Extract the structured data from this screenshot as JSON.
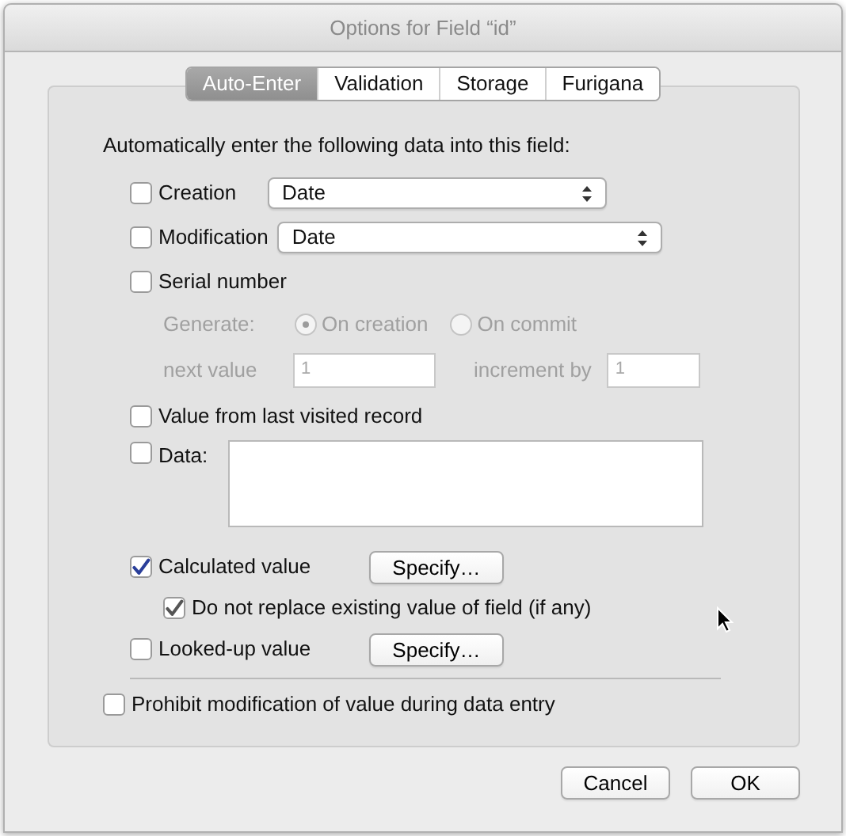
{
  "window": {
    "title": "Options for Field “id”"
  },
  "tabs": [
    {
      "label": "Auto-Enter",
      "selected": true
    },
    {
      "label": "Validation",
      "selected": false
    },
    {
      "label": "Storage",
      "selected": false
    },
    {
      "label": "Furigana",
      "selected": false
    }
  ],
  "panel": {
    "heading": "Automatically enter the following data into this field:",
    "options": [
      {
        "kind": "popup",
        "label": "Creation",
        "checked": false,
        "value": "Date"
      },
      {
        "kind": "popup",
        "label": "Modification",
        "checked": false,
        "value": "Date"
      },
      {
        "kind": "serial",
        "label": "Serial number",
        "checked": false,
        "disabled": true,
        "generate_label": "Generate:",
        "radios": [
          {
            "label": "On creation",
            "selected": true
          },
          {
            "label": "On commit",
            "selected": false
          }
        ],
        "next_label": "next value",
        "next_value": "1",
        "increment_label": "increment by",
        "increment_value": "1"
      },
      {
        "kind": "plain",
        "label": "Value from last visited record",
        "checked": false
      },
      {
        "kind": "data",
        "label": "Data:",
        "checked": false
      },
      {
        "kind": "specify",
        "label": "Calculated value",
        "checked": true,
        "button": "Specify…",
        "sub": {
          "label": "Do not replace existing value of field (if any)",
          "checked": true
        }
      },
      {
        "kind": "specify",
        "label": "Looked-up value",
        "checked": false,
        "button": "Specify…"
      }
    ],
    "prohibit": {
      "label": "Prohibit modification of value during data entry",
      "checked": false
    }
  },
  "buttons": [
    "Cancel",
    "OK"
  ]
}
